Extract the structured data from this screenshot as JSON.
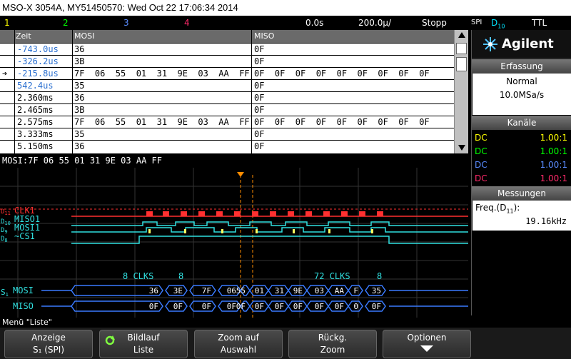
{
  "title": "MSO-X 3054A, MY51450570: Wed Oct 22 17:06:34 2014",
  "channels": [
    {
      "label": "1",
      "color": "#ffff00"
    },
    {
      "label": "2",
      "color": "#00ff00"
    },
    {
      "label": "3",
      "color": "#5a8cff"
    },
    {
      "label": "4",
      "color": "#ff2a6a"
    }
  ],
  "status": {
    "delay": "0.0s",
    "timebase": "200.0µ/",
    "run": "Stopp",
    "trigger_type": "SPI",
    "trigger_src": "D",
    "trigger_sub": "10",
    "level": "TTL"
  },
  "table": {
    "headers": [
      "Zeit",
      "MOSI",
      "MISO"
    ],
    "rows": [
      {
        "time": "-743.0us",
        "mosi": "36",
        "miso": "0F",
        "time_color": "#2a6fd0"
      },
      {
        "time": "-326.2us",
        "mosi": "3B",
        "miso": "0F",
        "time_color": "#2a6fd0"
      },
      {
        "time": "-215.8us",
        "mosi": "7F  06  55  01  31  9E  03  AA  FF",
        "miso": "0F  0F  0F  0F  0F  0F  0F  0F  0F",
        "time_color": "#2a6fd0",
        "selected": true
      },
      {
        "time": "542.4us",
        "mosi": "35",
        "miso": "0F",
        "time_color": "#2a6fd0"
      },
      {
        "time": "2.360ms",
        "mosi": "36",
        "miso": "0F",
        "time_color": "#000"
      },
      {
        "time": "2.465ms",
        "mosi": "3B",
        "miso": "0F",
        "time_color": "#000"
      },
      {
        "time": "2.575ms",
        "mosi": "7F  06  55  01  31  9E  03  AA  FF",
        "miso": "0F  0F  0F  0F  0F  0F  0F  0F  0F",
        "time_color": "#000"
      },
      {
        "time": "3.333ms",
        "mosi": "35",
        "miso": "0F",
        "time_color": "#000"
      },
      {
        "time": "5.150ms",
        "mosi": "36",
        "miso": "0F",
        "time_color": "#000"
      }
    ]
  },
  "decode_line": "MOSI:7F  06  55  01  31  9E  03  AA  FF",
  "waveform": {
    "labels": {
      "clk1": "CLK1",
      "miso1": "MISO1",
      "mosi1": "MOSI1",
      "cs1": "~CS1"
    },
    "dlabels": {
      "d11": "D",
      "d11s": "11",
      "d10": "D",
      "d10s": "10",
      "d9": "D",
      "d9s": "9",
      "d8": "D",
      "d8s": "8"
    },
    "clks_left": "8 CLKS",
    "clks_left_n": "8",
    "clks_right": "72 CLKS",
    "clks_right_n": "8",
    "bus_s": "S",
    "bus_s_sub": "1",
    "bus_mosi": "MOSI",
    "bus_miso": "MISO",
    "mosi_bytes": [
      "36",
      "3E",
      "7F",
      "06",
      "55",
      "01",
      "31",
      "9E",
      "03",
      "AA",
      "F",
      "35"
    ],
    "miso_bytes": [
      "0F",
      "0F",
      "0F",
      "0F",
      "0F",
      "0F",
      "0F",
      "0F",
      "0F",
      "0F",
      "0",
      "0F"
    ]
  },
  "panel": {
    "brand": "Agilent",
    "erfassung": "Erfassung",
    "mode": "Normal",
    "rate": "10.0MSa/s",
    "kanaele": "Kanäle",
    "channels": [
      {
        "coupling": "DC",
        "scale": "1.00:1",
        "color": "#ffff00"
      },
      {
        "coupling": "DC",
        "scale": "1.00:1",
        "color": "#00ff00"
      },
      {
        "coupling": "DC",
        "scale": "1.00:1",
        "color": "#5a8cff"
      },
      {
        "coupling": "DC",
        "scale": "1.00:1",
        "color": "#ff2a6a"
      }
    ],
    "messungen": "Messungen",
    "meas_label": "Freq.(D",
    "meas_sub": "11",
    "meas_suffix": "):",
    "meas_value": "19.16kHz"
  },
  "menu": "Menü \"Liste\"",
  "softkeys": [
    {
      "l1": "Anzeige",
      "l2": "S₁ (SPI)"
    },
    {
      "l1": "Bildlauf",
      "l2": "Liste"
    },
    {
      "l1": "Zoom auf",
      "l2": "Auswahl"
    },
    {
      "l1": "Rückg.",
      "l2": "Zoom"
    },
    {
      "l1": "Optionen",
      "l2": ""
    }
  ]
}
